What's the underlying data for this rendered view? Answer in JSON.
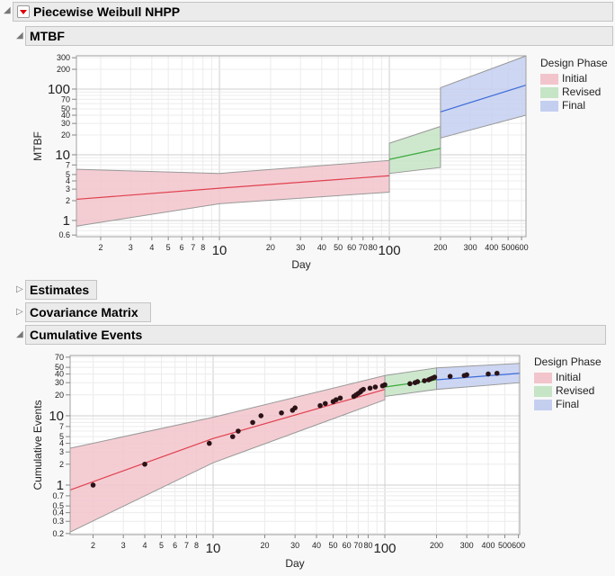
{
  "report": {
    "title": "Piecewise Weibull NHPP",
    "sections": {
      "mtbf": "MTBF",
      "estimates": "Estimates",
      "covariance": "Covariance Matrix",
      "cumulative": "Cumulative Events"
    }
  },
  "colors": {
    "Initial": {
      "fill": "#f2c4cb",
      "line": "#e0404e"
    },
    "Revised": {
      "fill": "#c6e4c6",
      "line": "#3caa3c"
    },
    "Final": {
      "fill": "#c4cff0",
      "line": "#3a6ad8"
    }
  },
  "chart_data": [
    {
      "type": "line",
      "title": "MTBF",
      "xlabel": "Day",
      "ylabel": "MTBF",
      "xscale": "log",
      "yscale": "log",
      "xlim": [
        1.44,
        637
      ],
      "ylim": [
        0.566,
        321
      ],
      "xticks": [
        2,
        3,
        4,
        5,
        6,
        7,
        8,
        10,
        20,
        30,
        40,
        50,
        60,
        70,
        80,
        100,
        200,
        300,
        400,
        500,
        600
      ],
      "xtick_labels": [
        "2",
        "3",
        "4",
        "5",
        "6",
        "7",
        "8",
        "10",
        "20",
        "30",
        "40",
        "50",
        "60",
        "70",
        "80",
        "100",
        "200",
        "300",
        "400",
        "500",
        "600"
      ],
      "yticks": [
        0.6,
        1,
        2,
        3,
        4,
        5,
        7,
        10,
        20,
        30,
        40,
        50,
        70,
        100,
        200,
        300
      ],
      "ytick_labels": [
        "0.6",
        "1",
        "2",
        "3",
        "4",
        "5",
        "7",
        "10",
        "20",
        "30",
        "40",
        "50",
        "70",
        "100",
        "200",
        "300"
      ],
      "legend_title": "Design Phase",
      "legend_position": "right",
      "series": [
        {
          "name": "Initial",
          "x": [
            1.44,
            10,
            100
          ],
          "estimate": [
            2.1,
            3.1,
            4.8
          ],
          "lower": [
            0.82,
            1.8,
            2.7
          ],
          "upper": [
            6.0,
            5.2,
            8.2
          ]
        },
        {
          "name": "Revised",
          "x": [
            100,
            200
          ],
          "estimate": [
            8.5,
            12.5
          ],
          "lower": [
            5.2,
            6.4
          ],
          "upper": [
            15,
            27
          ]
        },
        {
          "name": "Final",
          "x": [
            200,
            637
          ],
          "estimate": [
            45,
            115
          ],
          "lower": [
            18,
            40
          ],
          "upper": [
            105,
            320
          ]
        }
      ]
    },
    {
      "type": "scatter",
      "title": "Cumulative Events",
      "xlabel": "Day",
      "ylabel": "Cumulative Events",
      "xscale": "log",
      "yscale": "log",
      "xlim": [
        1.47,
        610
      ],
      "ylim": [
        0.193,
        74
      ],
      "xticks": [
        2,
        3,
        4,
        5,
        6,
        7,
        8,
        10,
        20,
        30,
        40,
        50,
        60,
        70,
        80,
        100,
        200,
        300,
        400,
        500,
        600
      ],
      "xtick_labels": [
        "2",
        "3",
        "4",
        "5",
        "6",
        "7",
        "8",
        "10",
        "20",
        "30",
        "40",
        "50",
        "60",
        "70",
        "80",
        "100",
        "200",
        "300",
        "400",
        "500",
        "600"
      ],
      "yticks": [
        0.2,
        0.3,
        0.4,
        0.5,
        0.7,
        1,
        2,
        3,
        4,
        5,
        7,
        10,
        20,
        30,
        40,
        50,
        70
      ],
      "ytick_labels": [
        "0.2",
        "0.3",
        "0.4",
        "0.5",
        "0.7",
        "1",
        "2",
        "3",
        "4",
        "5",
        "7",
        "10",
        "20",
        "30",
        "40",
        "50",
        "70"
      ],
      "legend_title": "Design Phase",
      "legend_position": "right",
      "series": [
        {
          "name": "Initial",
          "x": [
            1.47,
            10,
            100
          ],
          "estimate": [
            0.85,
            4.7,
            24
          ],
          "lower": [
            0.21,
            2.1,
            17
          ],
          "upper": [
            3.4,
            9.5,
            38
          ]
        },
        {
          "name": "Revised",
          "x": [
            100,
            200
          ],
          "estimate": [
            26,
            33
          ],
          "lower": [
            19,
            24
          ],
          "upper": [
            38,
            49
          ]
        },
        {
          "name": "Final",
          "x": [
            200,
            610
          ],
          "estimate": [
            33,
            41
          ],
          "lower": [
            24,
            30
          ],
          "upper": [
            49,
            57
          ]
        }
      ],
      "points": {
        "x": [
          2,
          4,
          9.5,
          13,
          14,
          17,
          19,
          25,
          29,
          30,
          42,
          45,
          50,
          52,
          55,
          66,
          68,
          70,
          72,
          73,
          75,
          82,
          88,
          97,
          100,
          140,
          150,
          155,
          170,
          180,
          185,
          190,
          195,
          240,
          290,
          300,
          400,
          450
        ],
        "y": [
          1,
          2,
          4,
          5,
          6,
          8,
          10,
          11,
          12,
          13,
          14,
          15,
          16,
          17,
          18,
          19,
          20,
          21,
          22,
          23,
          24,
          25,
          26,
          27,
          28,
          29,
          30,
          31,
          32,
          33,
          34,
          35,
          36,
          37,
          38,
          39,
          40,
          41
        ]
      }
    }
  ]
}
